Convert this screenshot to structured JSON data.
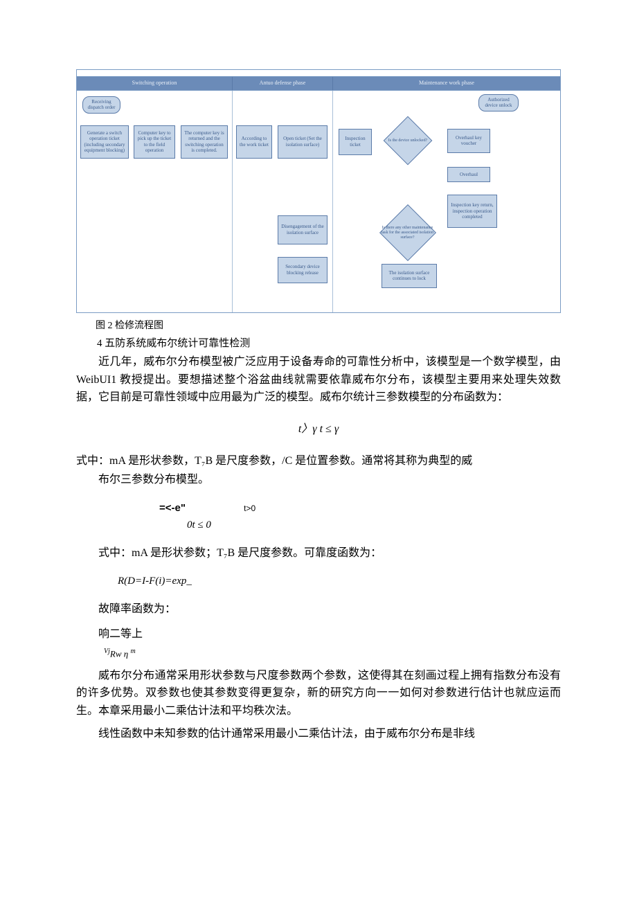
{
  "diagram": {
    "phases": [
      "Switching operation",
      "Antuo defense phase",
      "Maintenance work phase"
    ],
    "lane1": {
      "receive": "Receiving dispatch order",
      "generate": "Generate a switch operation ticket (including secondary equipment blocking)",
      "pickup": "Computer key to pick up the ticket to the field operation",
      "returned": "The computer key is returned and the switching operation is completed."
    },
    "lane2": {
      "according": "According to the work ticket",
      "open": "Open ticket (Set the isolation surface)",
      "disengage": "Disengagement of the isolation surface",
      "release": "Secondary device blocking release"
    },
    "lane3": {
      "inspect": "Inspection ticket",
      "unlocked": "Is the device unlocked?",
      "auth": "Authorized device unlock",
      "voucher": "Overhaul key voucher",
      "overhaul": "Overhaul",
      "anyother": "Is there any other maintenance task for the associated isolation surface?",
      "continues": "The isolation surface continues to lock",
      "return": "Inspection key return, inspection operation completed"
    }
  },
  "caption": "图 2 检修流程图",
  "section_title": "4 五防系统威布尔统计可靠性检测",
  "para1": "近几年，威布尔分布模型被广泛应用于设备寿命的可靠性分析中，该模型是一个数学模型，由 WeibUI1 教授提出。要想描述整个浴盆曲线就需要依靠威布尔分布，该模型主要用来处理失效数据，它目前是可靠性领域中应用最为广泛的模型。威布尔统计三参数模型的分布函数为：",
  "formula1": "t〉γ t ≤ γ",
  "para2_l1": "式中：mA 是形状参数，T₇B 是尺度参数，/C 是位置参数。通常将其称为典型的威",
  "para2_l2": "布尔三参数分布模型。",
  "formula2_r1": "=<-e\"",
  "formula2_t0": "t>0",
  "formula2_r2": "0t ≤ 0",
  "para3": "式中：mA 是形状参数；T₇B 是尺度参数。可靠度函数为：",
  "formula3": "R(D=I-F(i)=exp_",
  "para4": "故障率函数为：",
  "para5": "响二等上",
  "formula4_vj": "Vj",
  "formula4_rw": "Rw",
  "formula4_eta": "η",
  "formula4_m": "m",
  "para6": "威布尔分布通常采用形状参数与尺度参数两个参数，这使得其在刻画过程上拥有指数分布没有的许多优势。双参数也使其参数变得更复杂，新的研究方向一一如何对参数进行估计也就应运而生。本章采用最小二乘估计法和平均秩次法。",
  "para7": "线性函数中未知参数的估计通常采用最小二乘估计法，由于威布尔分布是非线"
}
